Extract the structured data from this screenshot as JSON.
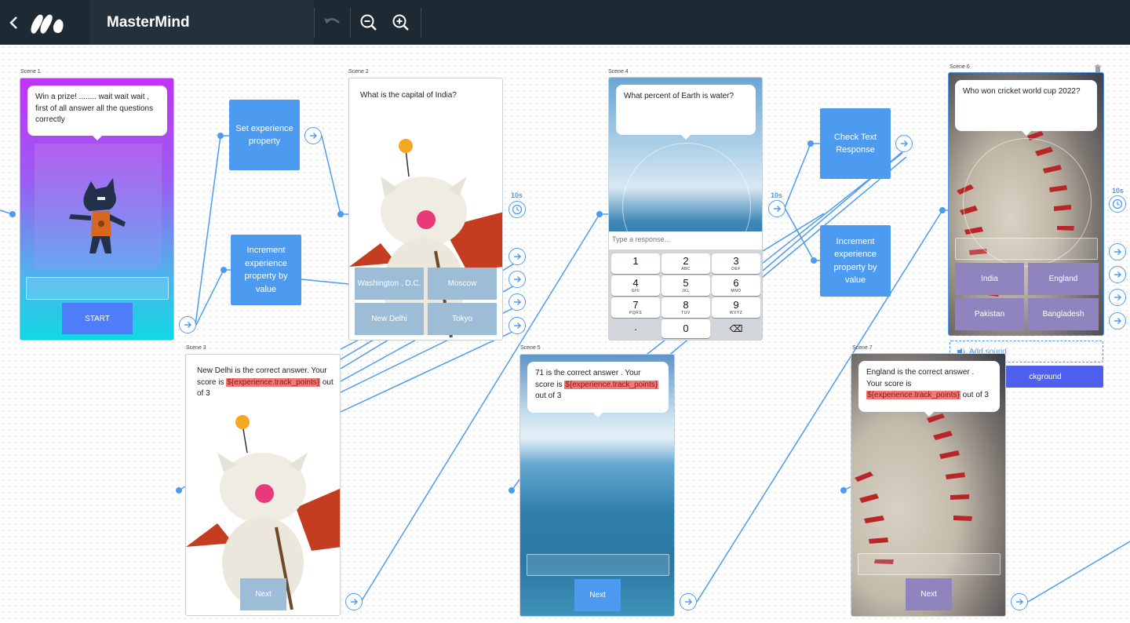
{
  "app": {
    "title": "MasterMind",
    "icons": {
      "back": "chevron-left-icon",
      "logo": "app-logo-icon",
      "undo": "undo-icon",
      "zoom_out": "zoom-out-icon",
      "zoom_in": "zoom-in-icon"
    }
  },
  "scenes": {
    "scene1": {
      "label": "Scene 1",
      "text": "Win a prize! ........ wait wait wait , first of all answer all the questions correctly",
      "button": "START"
    },
    "scene2": {
      "label": "Scene 2",
      "question": "What is the capital of India?",
      "options": [
        "Washington , D.C.",
        "Moscow",
        "New Delhi",
        "Tokyo"
      ],
      "timer": "10s"
    },
    "scene3": {
      "label": "Scene 3",
      "text_before": "New Delhi is the correct answer. Your score is ",
      "variable": "${experience.track_points}",
      "text_after": " out of 3",
      "button": "Next"
    },
    "scene4": {
      "label": "Scene 4",
      "question": "What percent of Earth is water?",
      "placeholder": "Type a response...",
      "timer": "10s",
      "keypad": [
        {
          "digit": "1",
          "letters": ""
        },
        {
          "digit": "2",
          "letters": "ABC"
        },
        {
          "digit": "3",
          "letters": "DEF"
        },
        {
          "digit": "4",
          "letters": "GHI"
        },
        {
          "digit": "5",
          "letters": "JKL"
        },
        {
          "digit": "6",
          "letters": "MNO"
        },
        {
          "digit": "7",
          "letters": "PQRS"
        },
        {
          "digit": "8",
          "letters": "TUV"
        },
        {
          "digit": "9",
          "letters": "WXYZ"
        },
        {
          "digit": ".",
          "letters": ""
        },
        {
          "digit": "0",
          "letters": ""
        },
        {
          "digit": "⌫",
          "letters": ""
        }
      ]
    },
    "scene5": {
      "label": "Scene 5",
      "text_before": "71 is the correct answer . Your score is ",
      "variable": "${experience.track_points}",
      "text_after": " out of 3",
      "button": "Next"
    },
    "scene6": {
      "label": "Scene 6",
      "question": "Who won cricket world cup 2022?",
      "options": [
        "India",
        "England",
        "Pakistan",
        "Bangladesh"
      ],
      "timer": "10s",
      "add_sound": "Add sound",
      "background_button": "ckground"
    },
    "scene7": {
      "label": "Scene 7",
      "text_before": "England is the correct answer . Your score is ",
      "variable": "${experience.track_points}",
      "text_after": " out of 3",
      "button": "Next"
    }
  },
  "actions": {
    "set_experience": "Set experience property",
    "increment_1": "Increment experience property by value",
    "check_text": "Check Text Response",
    "increment_2": "Increment experience property by value"
  },
  "colors": {
    "topbar": "#1e2a33",
    "wire": "#4d9bf0",
    "action": "#4d9bf0",
    "start_button": "#4f7df9",
    "option_scene2": "#9dbdd6",
    "option_scene6": "#8f84bd",
    "background_button": "#5060ee"
  }
}
